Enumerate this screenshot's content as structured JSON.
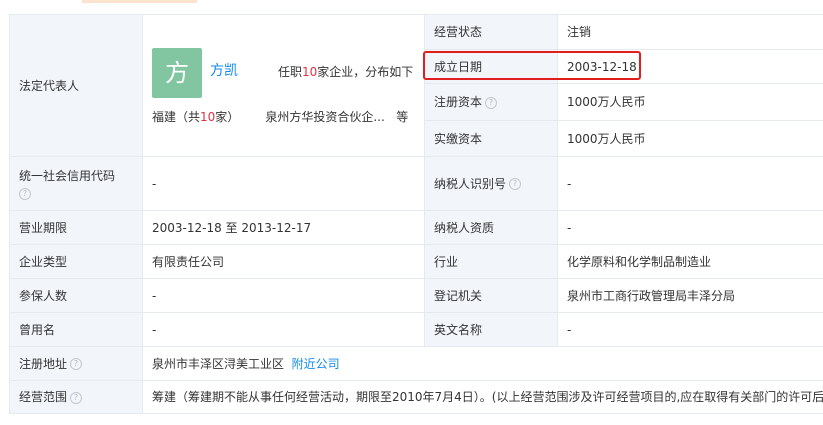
{
  "legal_rep": {
    "label": "法定代表人",
    "avatar_char": "方",
    "name": "方凯",
    "desc_prefix": "任职",
    "desc_count": "10",
    "desc_suffix": "家企业，分布如下",
    "region_prefix": "福建（共",
    "region_count": "10",
    "region_suffix": "家）",
    "company": "泉州方华投资合伙企...",
    "etc": "等"
  },
  "right_fields": {
    "status": {
      "label": "经营状态",
      "value": "注销"
    },
    "founded": {
      "label": "成立日期",
      "value": "2003-12-18"
    },
    "reg_capital": {
      "label": "注册资本",
      "value": "1000万人民币"
    },
    "paid_capital": {
      "label": "实缴资本",
      "value": "1000万人民币"
    },
    "taxpayer_id": {
      "label": "纳税人识别号",
      "value": "-"
    },
    "taxpayer_qual": {
      "label": "纳税人资质",
      "value": "-"
    },
    "industry": {
      "label": "行业",
      "value": "化学原料和化学制品制造业"
    },
    "authority": {
      "label": "登记机关",
      "value": "泉州市工商行政管理局丰泽分局"
    },
    "english_name": {
      "label": "英文名称",
      "value": "-"
    }
  },
  "left_fields": {
    "credit_code": {
      "label": "统一社会信用代码",
      "value": "-"
    },
    "term": {
      "label": "营业期限",
      "value": "2003-12-18 至 2013-12-17"
    },
    "company_type": {
      "label": "企业类型",
      "value": "有限责任公司"
    },
    "insured": {
      "label": "参保人数",
      "value": "-"
    },
    "former_name": {
      "label": "曾用名",
      "value": "-"
    }
  },
  "address": {
    "label": "注册地址",
    "value": "泉州市丰泽区浔美工业区",
    "link": "附近公司"
  },
  "scope": {
    "label": "经营范围",
    "value": "筹建（筹建期不能从事任何经营活动，期限至2010年7月4日）。(以上经营范围涉及许可经营项目的,应在取得有关部门的许可后方可经营)"
  },
  "icons": {
    "help": "question-circle-icon"
  },
  "colors": {
    "accent": "#128bed",
    "count_red": "#e33244",
    "highlight": "#e01e1e",
    "avatar_bg": "#81c6a1",
    "label_bg": "#f2f6fb"
  }
}
